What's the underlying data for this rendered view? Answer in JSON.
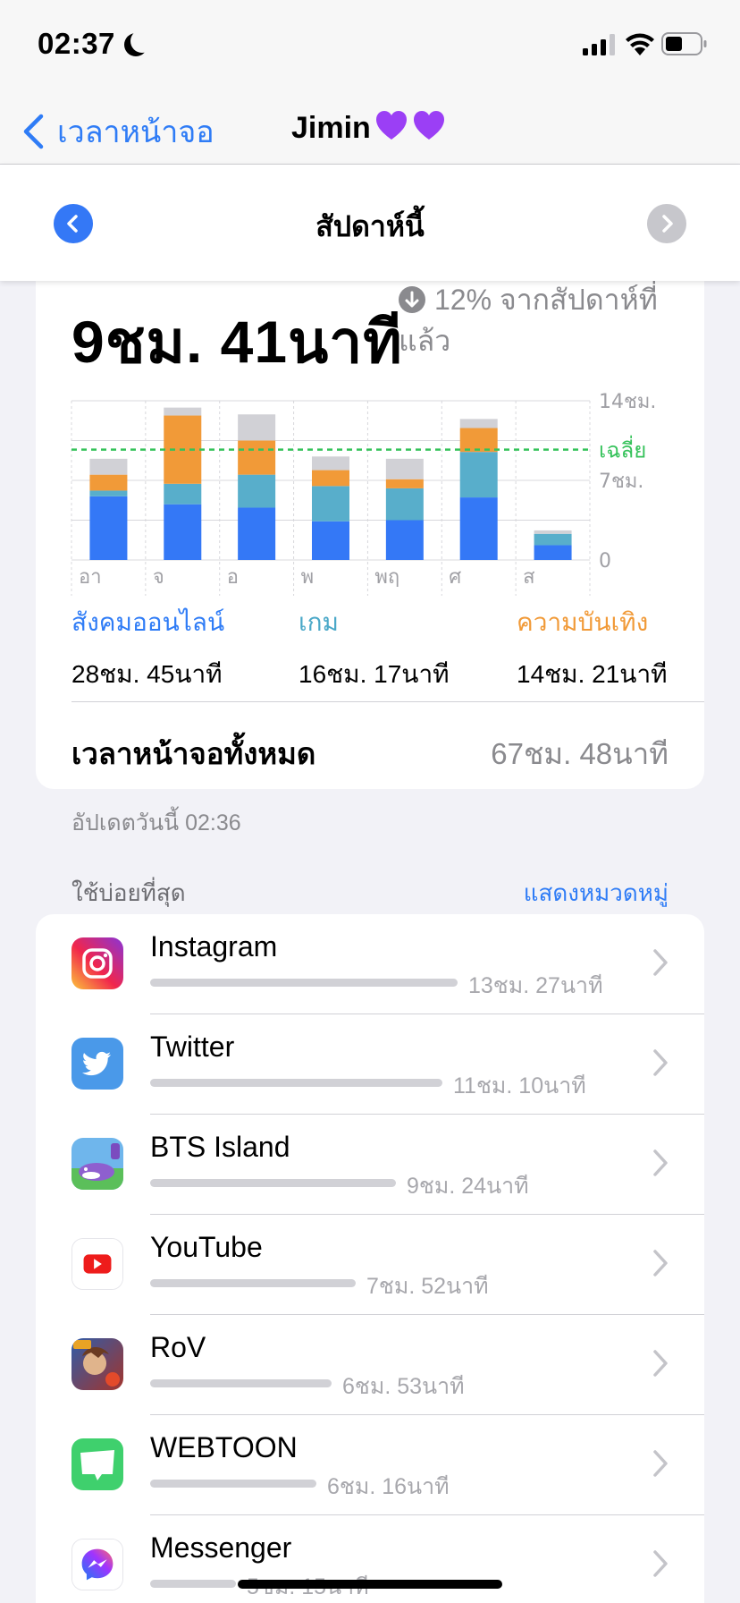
{
  "status_bar": {
    "time": "02:37"
  },
  "nav": {
    "back_label": "เวลาหน้าจอ",
    "title": "Jimin"
  },
  "week": {
    "label": "สัปดาห์นี้"
  },
  "summary": {
    "total": "9ชม. 41นาที",
    "change": "12% จากสัปดาห์ที่แล้ว",
    "average_label": "เฉลี่ย"
  },
  "chart_data": {
    "type": "bar",
    "stacked": true,
    "categories": [
      "อา",
      "จ",
      "อ",
      "พ",
      "พฤ",
      "ศ",
      "ส"
    ],
    "y_tick_labels": [
      "14ชม.",
      "7ชม.",
      "0"
    ],
    "ylim": [
      0,
      14
    ],
    "average": 9.7,
    "series": [
      {
        "name": "สังคมออนไลน์",
        "color": "#3478f6",
        "values": [
          5.6,
          4.9,
          4.6,
          3.4,
          3.5,
          5.5,
          1.3
        ]
      },
      {
        "name": "เกม",
        "color": "#58aecb",
        "values": [
          0.5,
          1.8,
          2.9,
          3.1,
          2.8,
          4.0,
          1.0
        ]
      },
      {
        "name": "ความบันเทิง",
        "color": "#f19a38",
        "values": [
          1.4,
          6.0,
          3.0,
          1.4,
          0.8,
          2.1,
          0
        ]
      },
      {
        "name": "อื่นๆ",
        "color": "#d1d1d6",
        "values": [
          1.4,
          0.7,
          2.3,
          1.2,
          1.8,
          0.8,
          0.3
        ]
      }
    ],
    "grid": true
  },
  "categories": [
    {
      "name": "สังคมออนไลน์",
      "value": "28ชม. 45นาที",
      "color": "#2f7cf6"
    },
    {
      "name": "เกม",
      "value": "16ชม. 17นาที",
      "color": "#4aa8c8"
    },
    {
      "name": "ความบันเทิง",
      "value": "14ชม. 21นาที",
      "color": "#f19a38"
    }
  ],
  "total_screen_time": {
    "label": "เวลาหน้าจอทั้งหมด",
    "value": "67ชม. 48นาที"
  },
  "updated": "อัปเดตวันนี้ 02:36",
  "most_used": {
    "title": "ใช้บ่อยที่สุด",
    "link": "แสดงหมวดหมู่",
    "apps": [
      {
        "name": "Instagram",
        "time": "13ชม. 27นาที",
        "usage_fraction": 1.0,
        "icon": "instagram-icon"
      },
      {
        "name": "Twitter",
        "time": "11ชม. 10นาที",
        "usage_fraction": 0.95,
        "icon": "twitter-icon"
      },
      {
        "name": "BTS Island",
        "time": "9ชม. 24นาที",
        "usage_fraction": 0.8,
        "icon": "bts-island-icon"
      },
      {
        "name": "YouTube",
        "time": "7ชม. 52นาที",
        "usage_fraction": 0.67,
        "icon": "youtube-icon"
      },
      {
        "name": "RoV",
        "time": "6ชม. 53นาที",
        "usage_fraction": 0.59,
        "icon": "rov-icon"
      },
      {
        "name": "WEBTOON",
        "time": "6ชม. 16นาที",
        "usage_fraction": 0.54,
        "icon": "webtoon-icon"
      },
      {
        "name": "Messenger",
        "time": "5ชม. 15นาที",
        "usage_fraction": 0.28,
        "icon": "messenger-icon"
      }
    ]
  }
}
